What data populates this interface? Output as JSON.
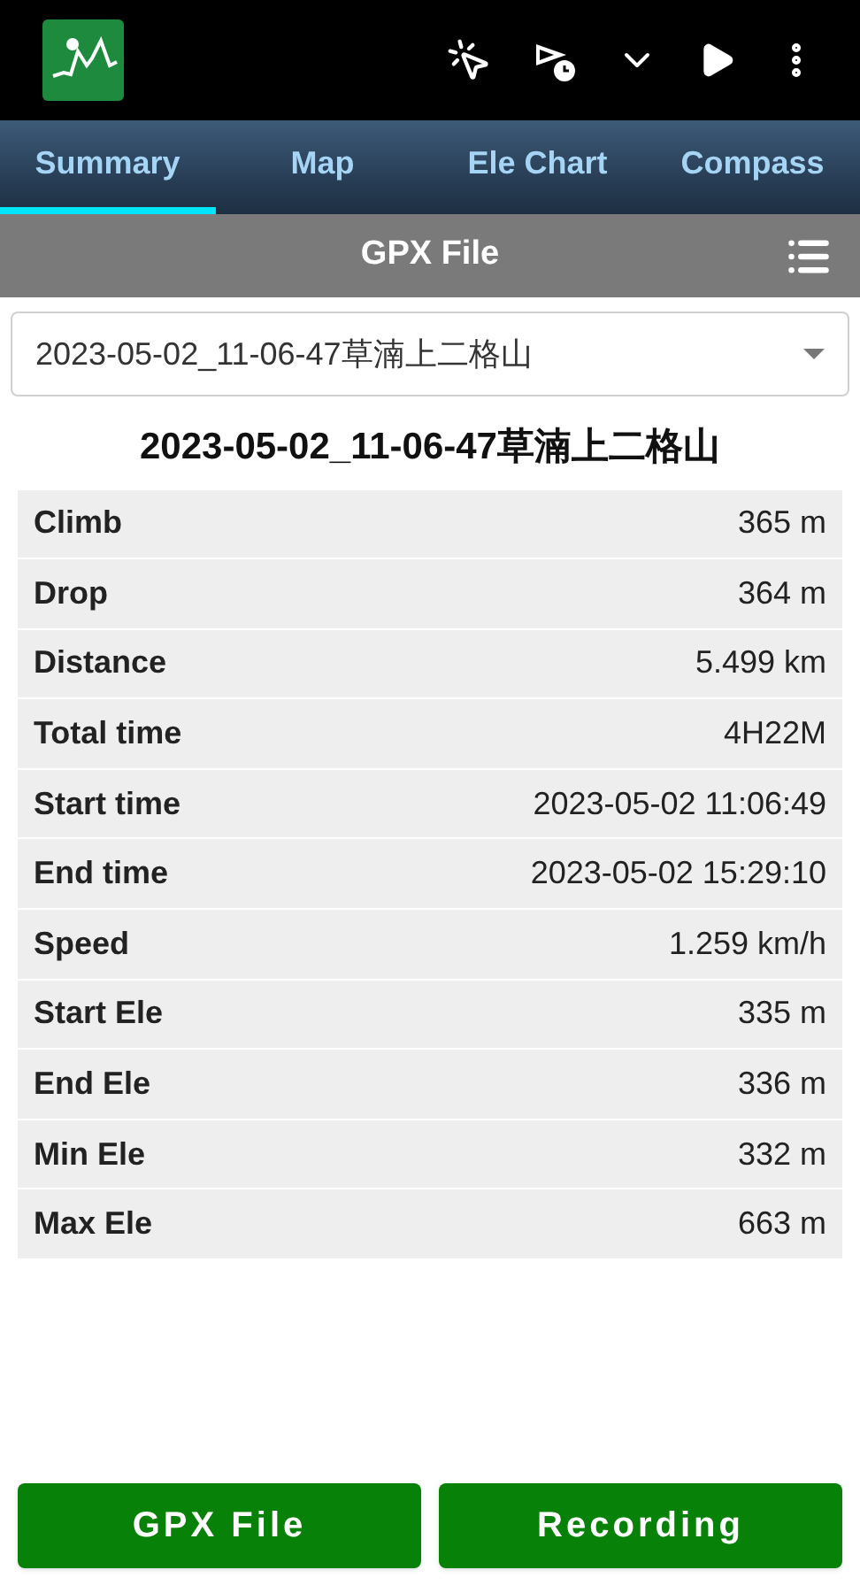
{
  "tabs": [
    {
      "label": "Summary",
      "selected": true
    },
    {
      "label": "Map",
      "selected": false
    },
    {
      "label": "Ele Chart",
      "selected": false
    },
    {
      "label": "Compass",
      "selected": false
    }
  ],
  "header": {
    "title": "GPX File"
  },
  "file_select": {
    "value": "2023-05-02_11-06-47草湳上二格山"
  },
  "summary": {
    "title": "2023-05-02_11-06-47草湳上二格山",
    "rows": [
      {
        "label": "Climb",
        "value": "365 m"
      },
      {
        "label": "Drop",
        "value": "364 m"
      },
      {
        "label": "Distance",
        "value": "5.499 km"
      },
      {
        "label": "Total time",
        "value": "4H22M"
      },
      {
        "label": "Start time",
        "value": "2023-05-02 11:06:49"
      },
      {
        "label": "End time",
        "value": "2023-05-02 15:29:10"
      },
      {
        "label": "Speed",
        "value": "1.259 km/h"
      },
      {
        "label": "Start Ele",
        "value": "335 m"
      },
      {
        "label": "End Ele",
        "value": "336 m"
      },
      {
        "label": "Min Ele",
        "value": "332 m"
      },
      {
        "label": "Max Ele",
        "value": "663 m"
      }
    ]
  },
  "buttons": [
    "GPX File",
    "Recording"
  ]
}
